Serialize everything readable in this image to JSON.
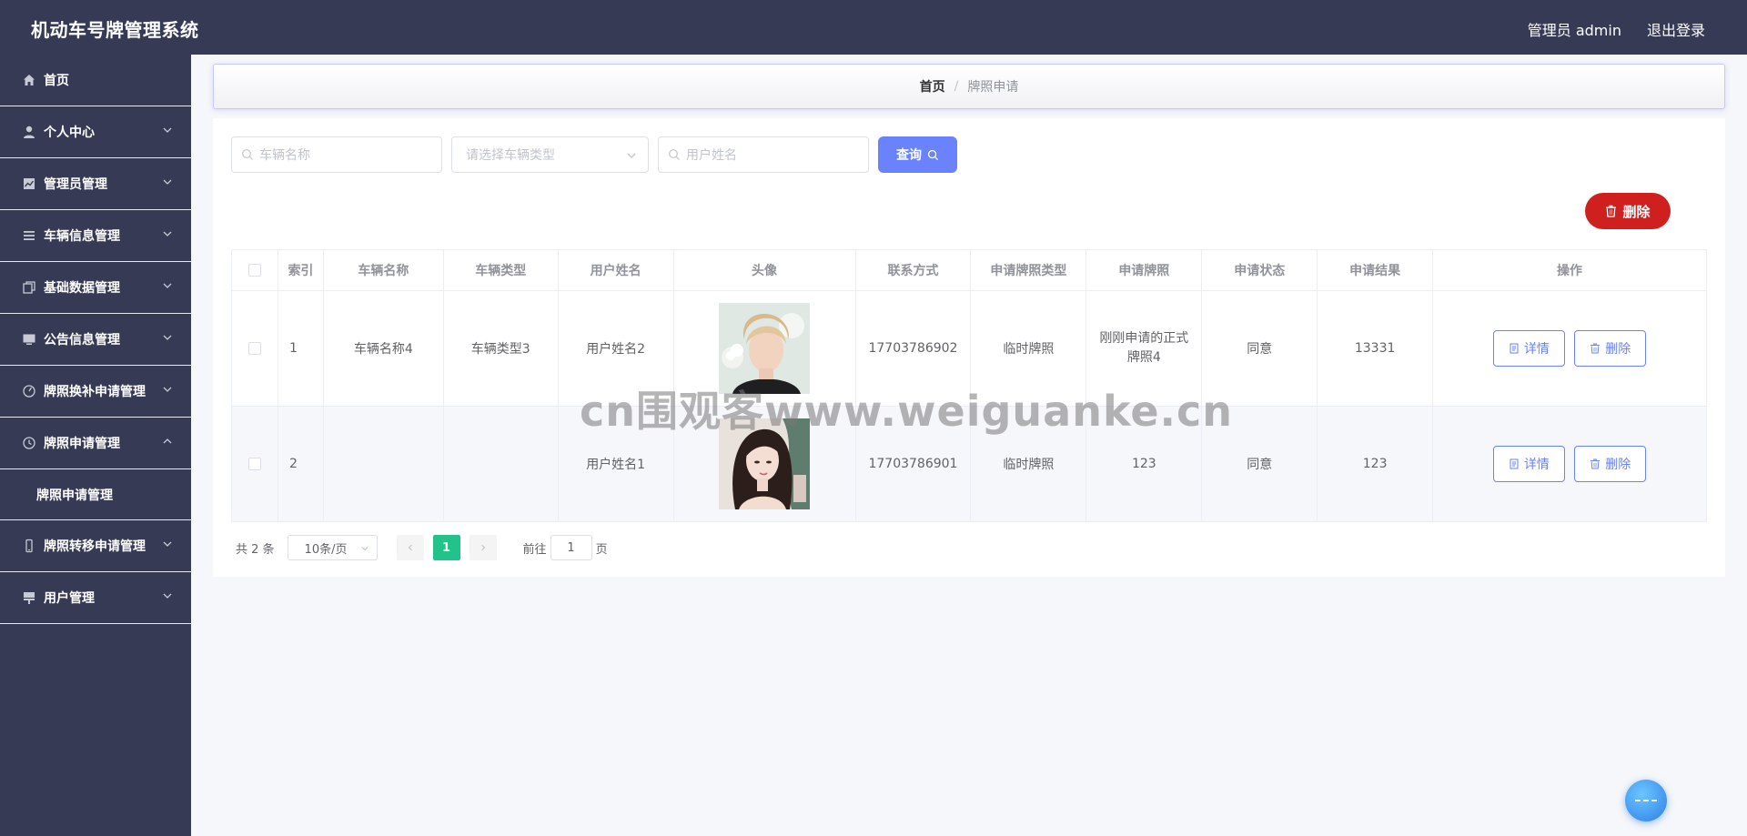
{
  "header": {
    "title": "机动车号牌管理系统",
    "user_label": "管理员 admin",
    "logout_label": "退出登录"
  },
  "sidebar": {
    "items": [
      {
        "label": "首页",
        "icon": "home-icon"
      },
      {
        "label": "个人中心",
        "icon": "user-icon"
      },
      {
        "label": "管理员管理",
        "icon": "chart-icon"
      },
      {
        "label": "车辆信息管理",
        "icon": "list-icon"
      },
      {
        "label": "基础数据管理",
        "icon": "copy-icon"
      },
      {
        "label": "公告信息管理",
        "icon": "monitor-icon"
      },
      {
        "label": "牌照换补申请管理",
        "icon": "gauge-icon"
      },
      {
        "label": "牌照申请管理",
        "icon": "clock-icon"
      },
      {
        "label": "牌照转移申请管理",
        "icon": "phone-icon"
      },
      {
        "label": "用户管理",
        "icon": "stamp-icon"
      }
    ],
    "sub_item": "牌照申请管理"
  },
  "breadcrumb": {
    "home": "首页",
    "separator": "/",
    "current": "牌照申请"
  },
  "search": {
    "vehicle_name_placeholder": "车辆名称",
    "vehicle_type_placeholder": "请选择车辆类型",
    "user_name_placeholder": "用户姓名",
    "query_label": "查询"
  },
  "actions": {
    "delete_label": "删除"
  },
  "table": {
    "headers": [
      "索引",
      "车辆名称",
      "车辆类型",
      "用户姓名",
      "头像",
      "联系方式",
      "申请牌照类型",
      "申请牌照",
      "申请状态",
      "申请结果",
      "操作"
    ],
    "rows": [
      {
        "index": "1",
        "vehicle_name": "车辆名称4",
        "vehicle_type": "车辆类型3",
        "user_name": "用户姓名2",
        "phone": "17703786902",
        "plate_type": "临时牌照",
        "plate": "刚刚申请的正式牌照4",
        "status": "同意",
        "result": "13331"
      },
      {
        "index": "2",
        "vehicle_name": "",
        "vehicle_type": "",
        "user_name": "用户姓名1",
        "phone": "17703786901",
        "plate_type": "临时牌照",
        "plate": "123",
        "status": "同意",
        "result": "123"
      }
    ],
    "detail_label": "详情",
    "delete_label": "删除"
  },
  "pager": {
    "total": "共 2 条",
    "page_size": "10条/页",
    "current_page": "1",
    "goto_label": "前往",
    "goto_value": "1",
    "page_suffix": "页"
  },
  "watermark": "cn围观客www.weiguanke.cn",
  "colors": {
    "sidebar_bg": "#363a55",
    "primary": "#6a82fb",
    "danger": "#cf1f1f",
    "page_active": "#21c38b"
  }
}
